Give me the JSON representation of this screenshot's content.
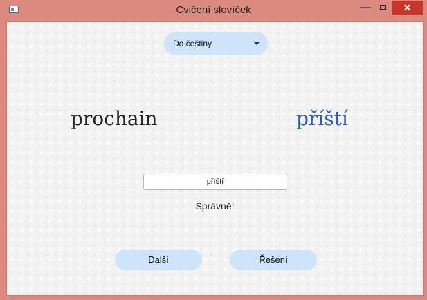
{
  "window": {
    "title": "Cvičení slovíček",
    "minimize_label": "—",
    "close_label": "✕"
  },
  "direction_select": {
    "selected": "Do češtiny"
  },
  "exercise": {
    "source_word": "prochain",
    "target_word": "příští",
    "answer_value": "příští",
    "feedback": "Správně!"
  },
  "buttons": {
    "next_label": "Další",
    "solution_label": "Řešení"
  },
  "colors": {
    "window_frame": "#dc8a80",
    "close_button": "#c7362b",
    "pill_button": "#cde4fb",
    "target_word": "#2a59b8"
  }
}
